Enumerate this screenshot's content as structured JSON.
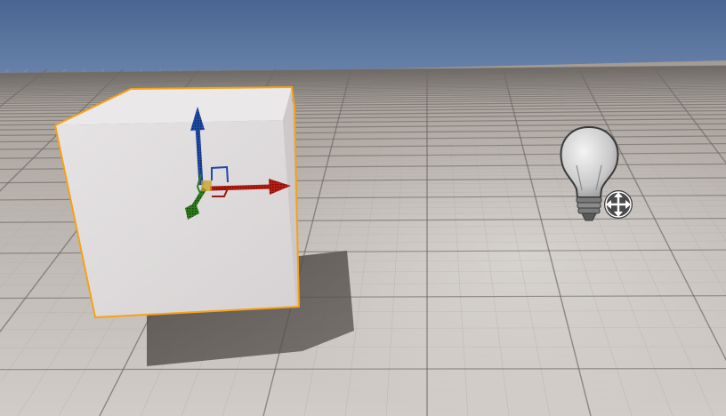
{
  "viewport": {
    "sky_color": "#4f6a95",
    "horizon_color": "#6f89b0",
    "floor_near_color": "#c8c3be",
    "floor_far_color": "#a79f98",
    "grid_major_color": "#6f6a66",
    "grid_minor_color": "#b2aca7",
    "shadow_color": "#4a4541"
  },
  "selected_actor": {
    "type": "cube",
    "face_top": "#ece9ea",
    "face_front": "#dcd8d9",
    "face_side": "#c9c5c6",
    "outline_color": "#f4a21a",
    "selected": true
  },
  "gizmo": {
    "mode": "translate",
    "x_axis_color": "#b81d14",
    "y_axis_color": "#2e7d1d",
    "z_axis_color": "#1e4aa8",
    "plane_color": "#c8a020"
  },
  "light_actor": {
    "icon": "lightbulb-icon",
    "move_icon": "move-arrows-icon",
    "bulb_color": "#c9c9c9",
    "base_color": "#7a7a7a"
  }
}
